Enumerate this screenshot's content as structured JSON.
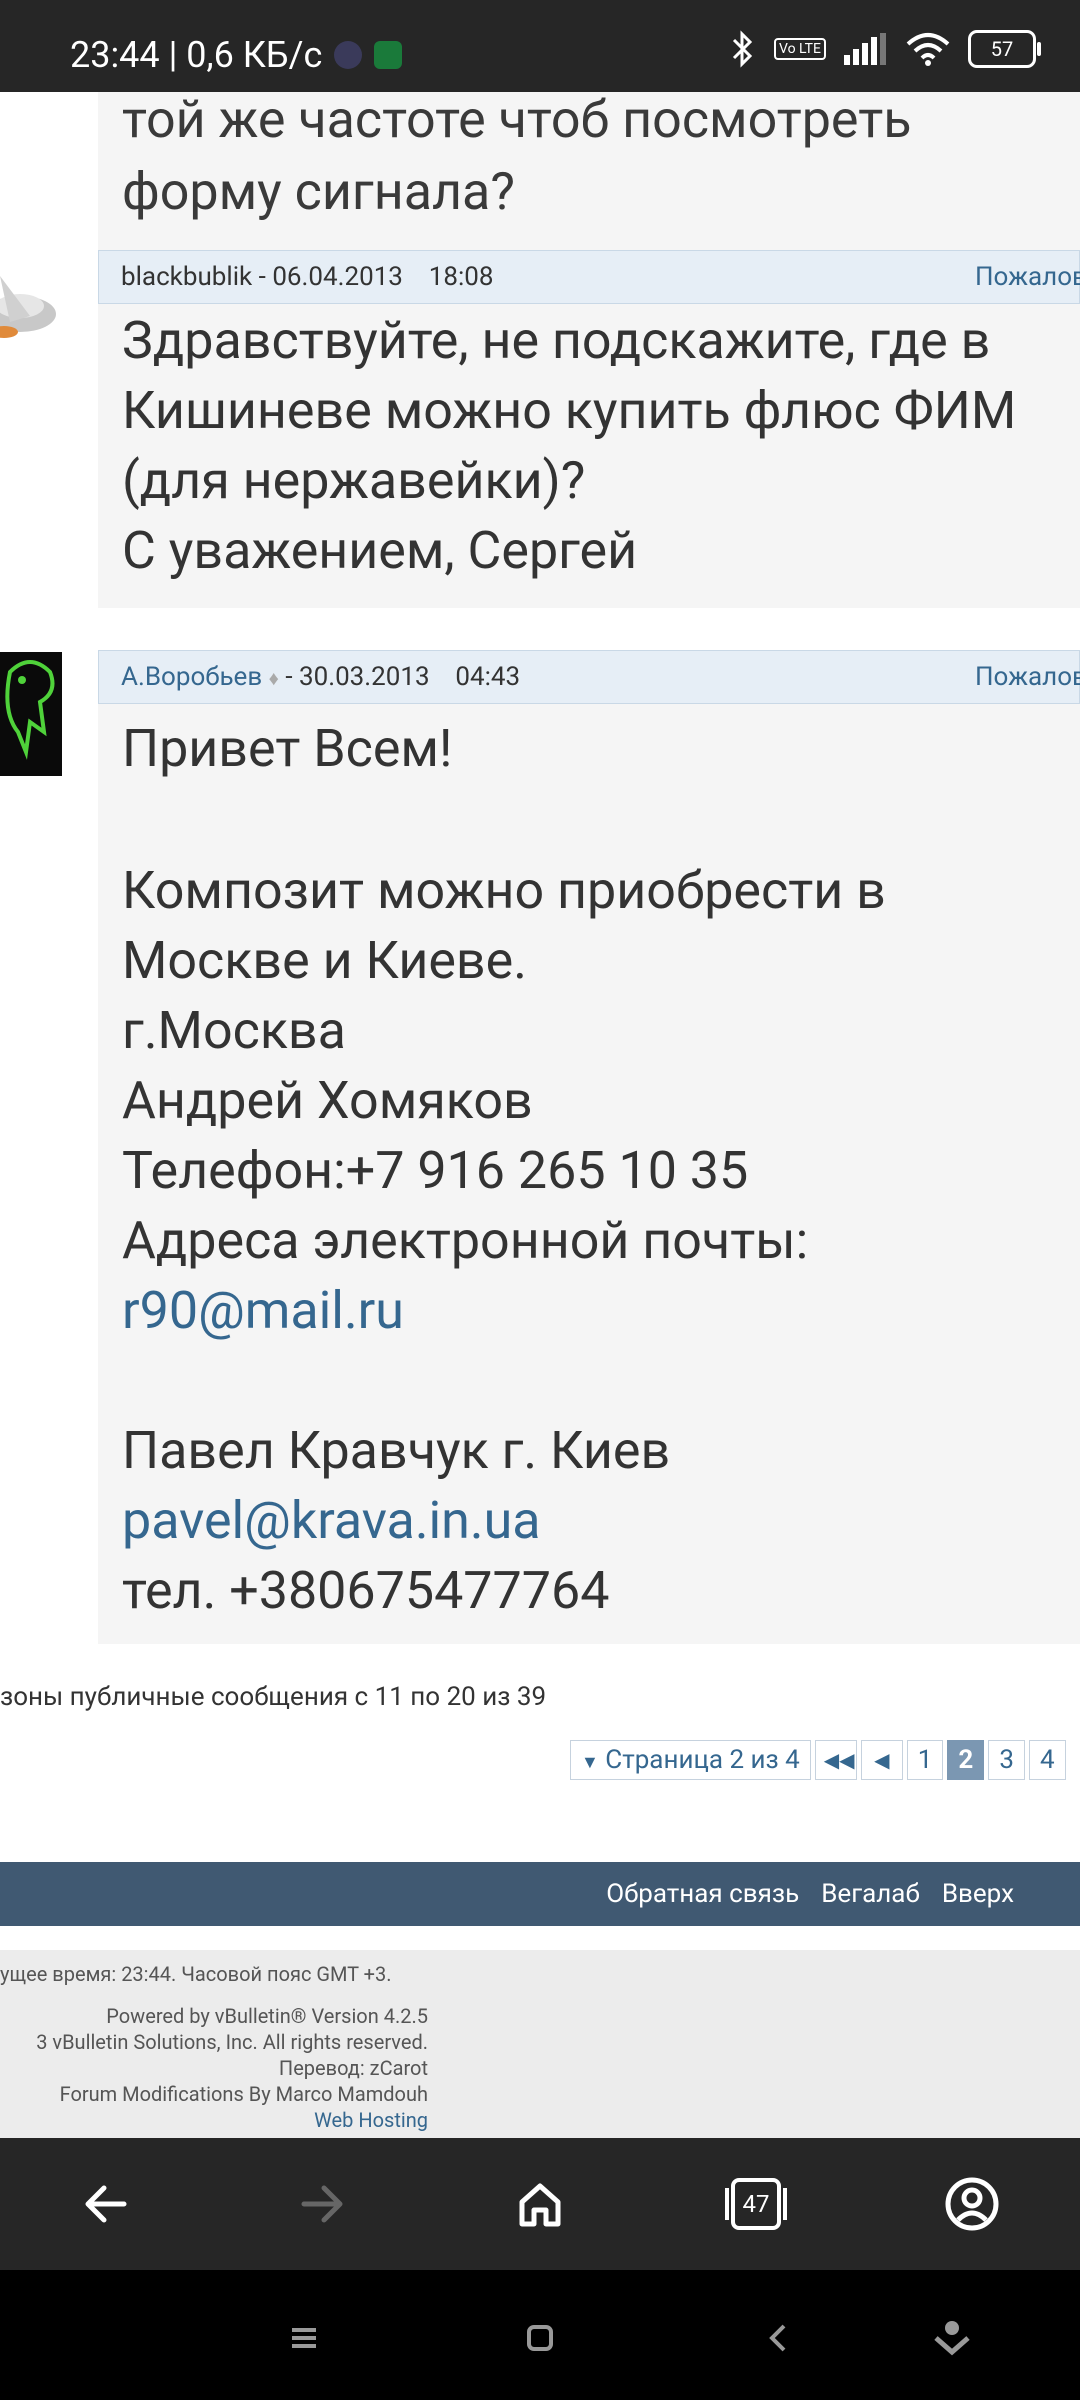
{
  "status_bar": {
    "time_speed": "23:44 | 0,6 КБ/с",
    "volte": "Vo LTE",
    "battery": "57"
  },
  "posts": {
    "top_body": {
      "line1": "той же частоте чтоб посмотреть",
      "line2": "форму сигнала?"
    },
    "post1": {
      "author": "blackbublik",
      "date": "06.04.2013",
      "time": "18:08",
      "report": "Пожаловаться",
      "lines": [
        "Здравствуйте, не подскажите, где в",
        "Кишиневе можно купить флюс ФИМ",
        "(для нержавейки)?",
        "С уважением, Сергей"
      ]
    },
    "post2": {
      "author": "А.Воробьев",
      "date": "30.03.2013",
      "time": "04:43",
      "report": "Пожаловаться",
      "greeting": "Привет Всем!",
      "lines": [
        "Композит можно приобрести в",
        "Москве и Киеве.",
        "г.Москва",
        "Андрей Хомяков",
        "Телефон:+7 916 265 10 35",
        "Адреса электронной почты:"
      ],
      "email1": "r90@mail.ru",
      "kiev_line": "Павел Кравчук г. Киев",
      "email2": "pavel@krava.in.ua",
      "phone2": "тел. +380675477764"
    }
  },
  "pagination": {
    "shown_text": "зоны публичные сообщения с 11 по 20 из 39",
    "page_label": "Страница 2 из 4",
    "pages": [
      "1",
      "2",
      "3",
      "4"
    ],
    "current": "2"
  },
  "footer": {
    "links": [
      "Обратная связь",
      "Вегалаб",
      "Вверх"
    ],
    "time_line": "ущее время: 23:44. Часовой пояс GMT +3.",
    "powered": "Powered by vBulletin® Version 4.2.5",
    "copyright": "3 vBulletin Solutions, Inc. All rights reserved.",
    "translation": "Перевод: zCarot",
    "mods": "Forum Modifications By Marco Mamdouh",
    "hosting": "Web Hosting"
  },
  "browser_nav": {
    "tab_count": "47"
  }
}
